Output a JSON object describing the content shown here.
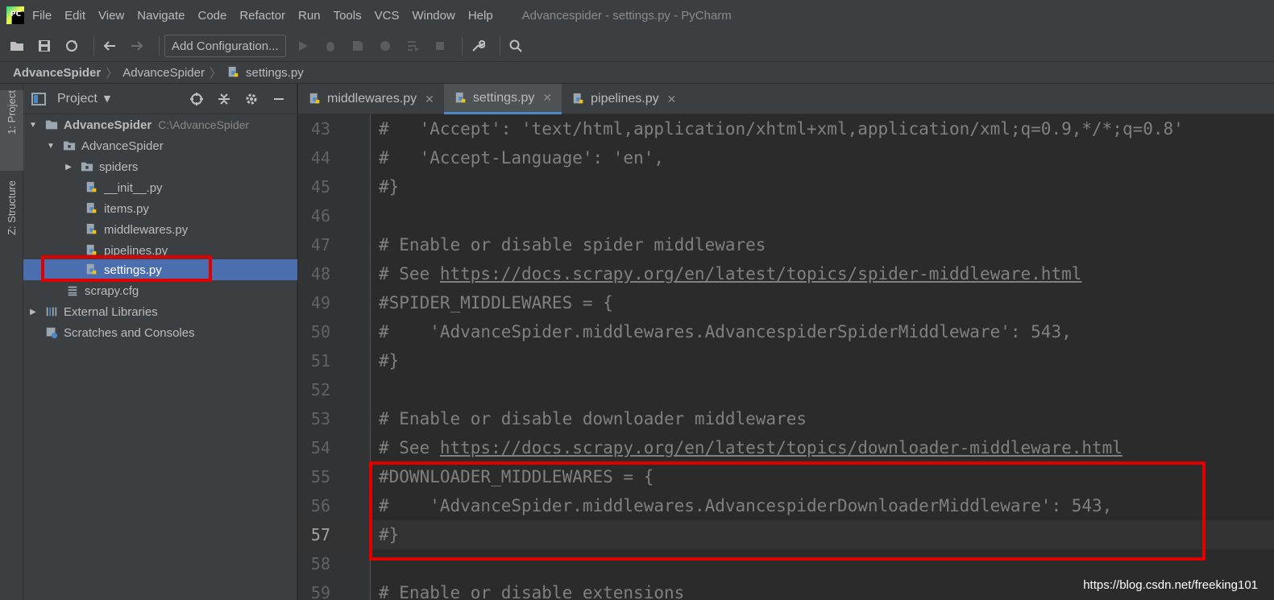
{
  "menubar": {
    "logo_text": "PC",
    "items": [
      {
        "label": "File"
      },
      {
        "label": "Edit"
      },
      {
        "label": "View"
      },
      {
        "label": "Navigate"
      },
      {
        "label": "Code"
      },
      {
        "label": "Refactor"
      },
      {
        "label": "Run"
      },
      {
        "label": "Tools"
      },
      {
        "label": "VCS"
      },
      {
        "label": "Window"
      },
      {
        "label": "Help"
      }
    ],
    "window_title": "Advancespider - settings.py - PyCharm"
  },
  "toolbar": {
    "run_config_label": "Add Configuration..."
  },
  "breadcrumb": {
    "items": [
      "AdvanceSpider",
      "AdvanceSpider",
      "settings.py"
    ]
  },
  "left_strip": {
    "project_tab": "1: Project",
    "structure_tab": "Z: Structure"
  },
  "project_panel": {
    "title": "Project",
    "tree": [
      {
        "label": "AdvanceSpider",
        "hint": "C:\\AdvanceSpider"
      },
      {
        "label": "AdvanceSpider"
      },
      {
        "label": "spiders"
      },
      {
        "label": "__init__.py"
      },
      {
        "label": "items.py"
      },
      {
        "label": "middlewares.py"
      },
      {
        "label": "pipelines.py"
      },
      {
        "label": "settings.py"
      },
      {
        "label": "scrapy.cfg"
      },
      {
        "label": "External Libraries"
      },
      {
        "label": "Scratches and Consoles"
      }
    ]
  },
  "editor_tabs": [
    {
      "label": "middlewares.py"
    },
    {
      "label": "settings.py",
      "active": true
    },
    {
      "label": "pipelines.py"
    }
  ],
  "editor": {
    "current_line": 57,
    "lines": [
      {
        "num": "43",
        "text": "#   'Accept': 'text/html,application/xhtml+xml,application/xml;q=0.9,*/*;q=0.8'"
      },
      {
        "num": "44",
        "text": "#   'Accept-Language': 'en',"
      },
      {
        "num": "45",
        "text": "#}"
      },
      {
        "num": "46",
        "text": ""
      },
      {
        "num": "47",
        "text": "# Enable or disable spider middlewares"
      },
      {
        "num": "48",
        "text": "# See https://docs.scrapy.org/en/latest/topics/spider-middleware.html"
      },
      {
        "num": "49",
        "text": "#SPIDER_MIDDLEWARES = {"
      },
      {
        "num": "50",
        "text": "#    'AdvanceSpider.middlewares.AdvancespiderSpiderMiddleware': 543,"
      },
      {
        "num": "51",
        "text": "#}"
      },
      {
        "num": "52",
        "text": ""
      },
      {
        "num": "53",
        "text": "# Enable or disable downloader middlewares"
      },
      {
        "num": "54",
        "text": "# See https://docs.scrapy.org/en/latest/topics/downloader-middleware.html"
      },
      {
        "num": "55",
        "text": "#DOWNLOADER_MIDDLEWARES = {"
      },
      {
        "num": "56",
        "text": "#    'AdvanceSpider.middlewares.AdvancespiderDownloaderMiddleware': 543,"
      },
      {
        "num": "57",
        "text": "#}"
      },
      {
        "num": "58",
        "text": ""
      },
      {
        "num": "59",
        "text": "# Enable or disable extensions"
      }
    ]
  },
  "watermark": "https://blog.csdn.net/freeking101",
  "colors": {
    "bg_editor": "#2b2b2b",
    "bg_panel": "#3c3f41",
    "selection": "#4b6eaf",
    "highlight_box": "#e00000",
    "comment": "#808080"
  }
}
